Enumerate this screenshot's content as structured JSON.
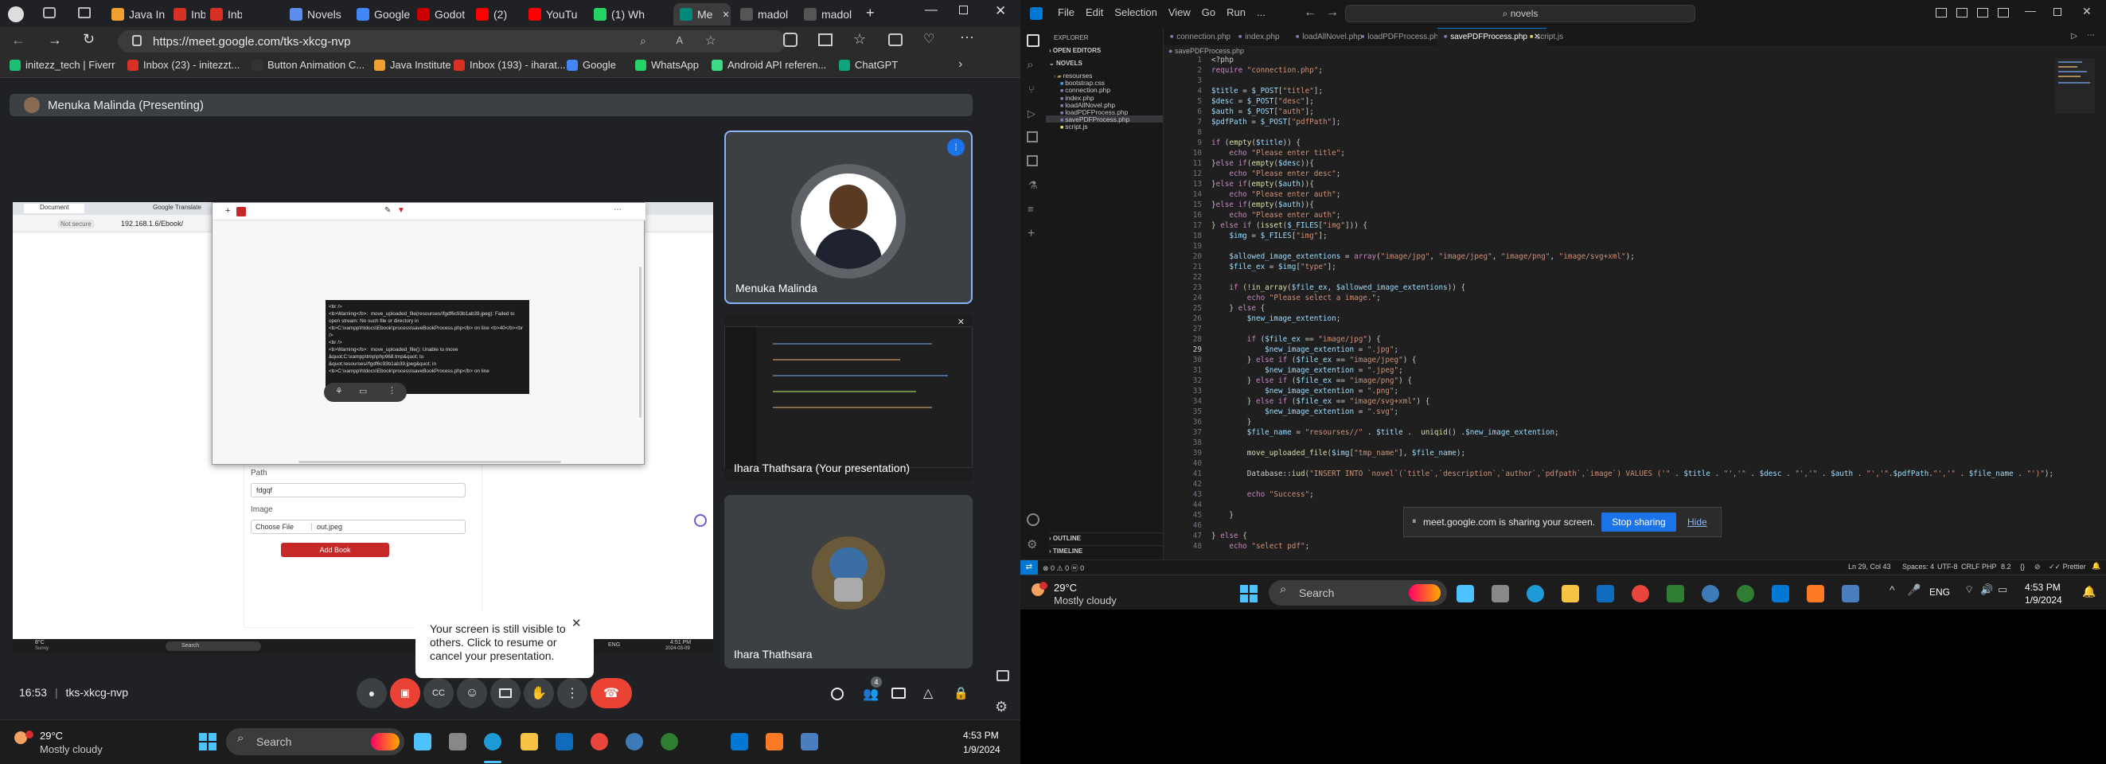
{
  "edge": {
    "tabs": [
      {
        "label": "Java In",
        "color": "#f0a030"
      },
      {
        "label": "Inbox (",
        "color": "#d93025"
      },
      {
        "label": "Inbox (",
        "color": "#d93025"
      },
      {
        "label": "Novels",
        "color": "#5a8dee"
      },
      {
        "label": "Google",
        "color": "#4285f4"
      },
      {
        "label": "Godot",
        "color": "#c00"
      },
      {
        "label": "(2)",
        "color": "#ff0000"
      },
      {
        "label": "YouTu",
        "color": "#ff0000"
      },
      {
        "label": "(1) Wh",
        "color": "#25d366"
      },
      {
        "label": "Me",
        "color": "#00897b"
      },
      {
        "label": "madol",
        "color": "#555"
      },
      {
        "label": "madol",
        "color": "#555"
      }
    ],
    "url": "https://meet.google.com/tks-xkcg-nvp",
    "favorites": [
      {
        "label": "initezz_tech | Fiverr",
        "color": "#1dbf73"
      },
      {
        "label": "Inbox (23) - initezzt...",
        "color": "#d93025"
      },
      {
        "label": "Button Animation C...",
        "color": "#333"
      },
      {
        "label": "Java Institute",
        "color": "#f0a030"
      },
      {
        "label": "Inbox (193) - iharat...",
        "color": "#d93025"
      },
      {
        "label": "Google",
        "color": "#4285f4"
      },
      {
        "label": "WhatsApp",
        "color": "#25d366"
      },
      {
        "label": "Android API referen...",
        "color": "#3ddc84"
      },
      {
        "label": "ChatGPT",
        "color": "#10a37f"
      }
    ],
    "favorites_more_icon": "chevron-right-icon"
  },
  "meet": {
    "presenting_label": "Menuka Malinda (Presenting)",
    "shared_content": {
      "mini_tabs": [
        "Document",
        "Google Translate"
      ],
      "mini_url_warning": "Not secure",
      "mini_url": "192.168.1.6/Ebook/",
      "error_text": "<br />\n<b>Warning</b>:  move_uploaded_file(resourses//fgdf6c93b1ab39.jpeg): Failed to open stream: No such file or directory in <b>C:\\xampp\\htdocs\\Ebook\\process\\saveBookProcess.php</b> on line <b>40</b><br />\n<br />\n<b>Warning</b>:  move_uploaded_file(): Unable to move &quot;C:\\xampp\\tmp\\php968.tmp&quot; to &quot;resourses//fgdf6c93b1ab39.jpeg&quot; in <b>C:\\xampp\\htdocs\\Ebook\\process\\saveBookProcess.php</b> on line",
      "form": {
        "path_label": "Path",
        "path_value": "fdgqf",
        "image_label": "Image",
        "choose_file_label": "Choose File",
        "file_name": "out.jpeg",
        "add_book_label": "Add Book"
      },
      "mini_taskbar": {
        "weather_temp": "8°C",
        "weather_desc": "Sunny",
        "search": "Search",
        "time": "4:51 PM",
        "date": "2024-03-09",
        "lang": "ENG"
      }
    },
    "participants": [
      {
        "name": "Menuka Malinda"
      },
      {
        "name": "Ihara Thathsara (Your presentation)"
      },
      {
        "name": "Ihara Thathsara"
      }
    ],
    "tooltip": "Your screen is still visible to others. Click to resume or cancel your presentation.",
    "time": "16:53",
    "meeting_code": "tks-xkcg-nvp",
    "people_count": "4"
  },
  "taskbar_left": {
    "temperature": "29°C",
    "weather": "Mostly cloudy",
    "search": "Search",
    "time": "4:53 PM",
    "date": "1/9/2024"
  },
  "vscode": {
    "menu": [
      "File",
      "Edit",
      "Selection",
      "View",
      "Go",
      "Run",
      "..."
    ],
    "search": "novels",
    "explorer_title": "EXPLORER",
    "open_editors": "OPEN EDITORS",
    "folder": "NOVELS",
    "files": [
      {
        "name": "resourses",
        "type": "folder"
      },
      {
        "name": "bootstrap.css",
        "type": "css"
      },
      {
        "name": "connection.php",
        "type": "php"
      },
      {
        "name": "index.php",
        "type": "php"
      },
      {
        "name": "loadAllNovel.php",
        "type": "php"
      },
      {
        "name": "loadPDFProcess.php",
        "type": "php"
      },
      {
        "name": "savePDFProcess.php",
        "type": "php",
        "active": true
      },
      {
        "name": "script.js",
        "type": "js"
      }
    ],
    "outline": "OUTLINE",
    "timeline": "TIMELINE",
    "tabs": [
      "connection.php",
      "index.php",
      "loadAllNovel.php",
      "loadPDFProcess.php",
      "savePDFProcess.php",
      "script.js"
    ],
    "active_tab": "savePDFProcess.php",
    "breadcrumb": "savePDFProcess.php",
    "code_lines": [
      "<?php",
      "require \"connection.php\";",
      "",
      "$title = $_POST[\"title\"];",
      "$desc = $_POST[\"desc\"];",
      "$auth = $_POST[\"auth\"];",
      "$pdfPath = $_POST[\"pdfPath\"];",
      "",
      "if (empty($title)) {",
      "    echo \"Please enter title\";",
      "}else if(empty($desc)){",
      "    echo \"Please enter desc\";",
      "}else if(empty($auth)){",
      "    echo \"Please enter auth\";",
      "}else if(empty($auth)){",
      "    echo \"Please enter auth\";",
      "} else if (isset($_FILES[\"img\"])) {",
      "    $img = $_FILES[\"img\"];",
      "",
      "    $allowed_image_extentions = array(\"image/jpg\", \"image/jpeg\", \"image/png\", \"image/svg+xml\");",
      "    $file_ex = $img[\"type\"];",
      "",
      "    if (!in_array($file_ex, $allowed_image_extentions)) {",
      "        echo \"Please select a image.\";",
      "    } else {",
      "        $new_image_extention;",
      "",
      "        if ($file_ex == \"image/jpg\") {",
      "            $new_image_extention = \".jpg\";",
      "        } else if ($file_ex == \"image/jpeg\") {",
      "            $new_image_extention = \".jpeg\";",
      "        } else if ($file_ex == \"image/png\") {",
      "            $new_image_extention = \".png\";",
      "        } else if ($file_ex == \"image/svg+xml\") {",
      "            $new_image_extention = \".svg\";",
      "        }",
      "        $file_name = \"resourses//\" . $title .  uniqid() .$new_image_extention;",
      "",
      "        move_uploaded_file($img[\"tmp_name\"], $file_name);",
      "",
      "        Database::iud(\"INSERT INTO `novel`(`title`,`description`,`author`,`pdfpath`,`image`) VALUES ('\" . $title . \"','\" . $desc . \"','\" . $auth . \"','\".$pdfPath.\"','\" . $file_name . \"')\");",
      "",
      "        echo \"Success\";",
      "",
      "    }",
      "",
      "} else {",
      "    echo \"select pdf\";"
    ],
    "status": {
      "left": "⊗ 0 ⚠ 0   ⓦ 0",
      "position": "Ln 29, Col 43",
      "spaces": "Spaces: 4",
      "encoding": "UTF-8",
      "eol": "CRLF",
      "lang": "PHP",
      "version": "8.2",
      "prettier": "Prettier"
    }
  },
  "share_banner": {
    "text": "meet.google.com is sharing your screen.",
    "stop": "Stop sharing",
    "hide": "Hide"
  },
  "taskbar_right": {
    "temperature": "29°C",
    "weather": "Mostly cloudy",
    "search": "Search",
    "lang": "ENG",
    "time": "4:53 PM",
    "date": "1/9/2024"
  }
}
